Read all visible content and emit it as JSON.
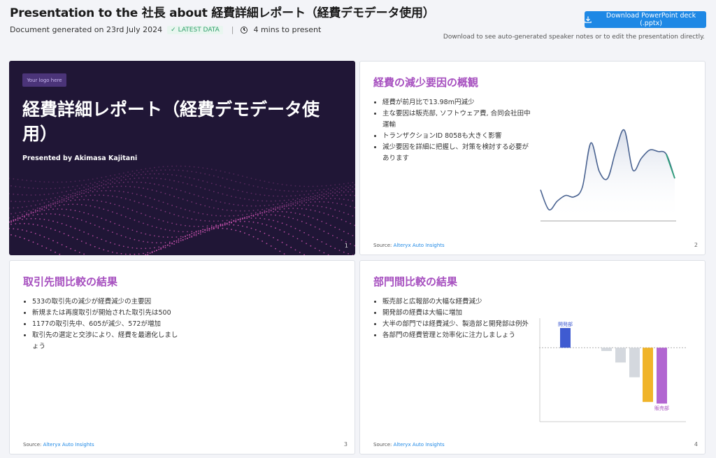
{
  "header": {
    "title": "Presentation to the 社長 about 経費詳細レポート（経費デモデータ使用）",
    "generated": "Document generated on 23rd July 2024",
    "badge": "LATEST DATA",
    "separator": "|",
    "duration": "4 mins to present",
    "download_label": "Download PowerPoint deck (.pptx)",
    "download_note": "Download to see auto-generated speaker notes or to edit the presentation directly.",
    "icons": [
      "check-icon",
      "clock-icon",
      "download-icon"
    ],
    "accent": "#1e88e5"
  },
  "slides": [
    {
      "number": "1",
      "logo": "Your logo here",
      "title": "経費詳細レポート（経費デモデータ使用）",
      "presenter": "Presented by Akimasa Kajitani",
      "bg": "#201636"
    },
    {
      "number": "2",
      "title": "経費の減少要因の概観",
      "bullets": [
        "経費が前月比で13.98m円減少",
        "主な要因は販売部, ソフトウェア費, 合同会社田中運輸",
        "トランザクションID 8058も大きく影響",
        "減少要因を詳細に把握し、対策を検討する必要があります"
      ],
      "source_prefix": "Source: ",
      "source_link": "Alteryx Auto Insights"
    },
    {
      "number": "3",
      "title": "取引先間比較の結果",
      "bullets": [
        "533の取引先の減少が経費減少の主要因",
        "新規または再度取引が開始された取引先は500",
        "1177の取引先中、605が減少、572が増加",
        "取引先の選定と交渉により、経費を最適化しましょう"
      ],
      "source_prefix": "Source: ",
      "source_link": "Alteryx Auto Insights"
    },
    {
      "number": "4",
      "title": "部門間比較の結果",
      "bullets": [
        "販売部と広報部の大幅な経費減少",
        "開発部の経費は大幅に増加",
        "大半の部門では経費減少、製造部と開発部は例外",
        "各部門の経費管理と効率化に注力しましょう"
      ],
      "source_prefix": "Source: ",
      "source_link": "Alteryx Auto Insights"
    }
  ],
  "chart_data": [
    {
      "type": "line",
      "values": [
        22,
        8,
        14,
        18,
        17,
        24,
        55,
        35,
        30,
        50,
        64,
        36,
        44,
        50,
        49,
        47,
        30
      ],
      "highlight_from_index": 15,
      "line_color": "#4a6391",
      "highlight_color": "#2e9e7a",
      "ylim": [
        0,
        70
      ]
    },
    {
      "type": "bar",
      "categories": [
        "開発部",
        "",
        "",
        "",
        "",
        "",
        "販売部"
      ],
      "values": [
        12,
        0,
        -2,
        -9,
        -18,
        -33,
        -34
      ],
      "colors": [
        "#3f5bd1",
        "#ffffff",
        "#d4d8de",
        "#d4d8de",
        "#d4d8de",
        "#f0b429",
        "#b266d1"
      ],
      "label_colors": [
        "#3f5bd1",
        "",
        "",
        "",
        "",
        "",
        "#a64fbf"
      ],
      "ylim": [
        -45,
        18
      ]
    }
  ]
}
